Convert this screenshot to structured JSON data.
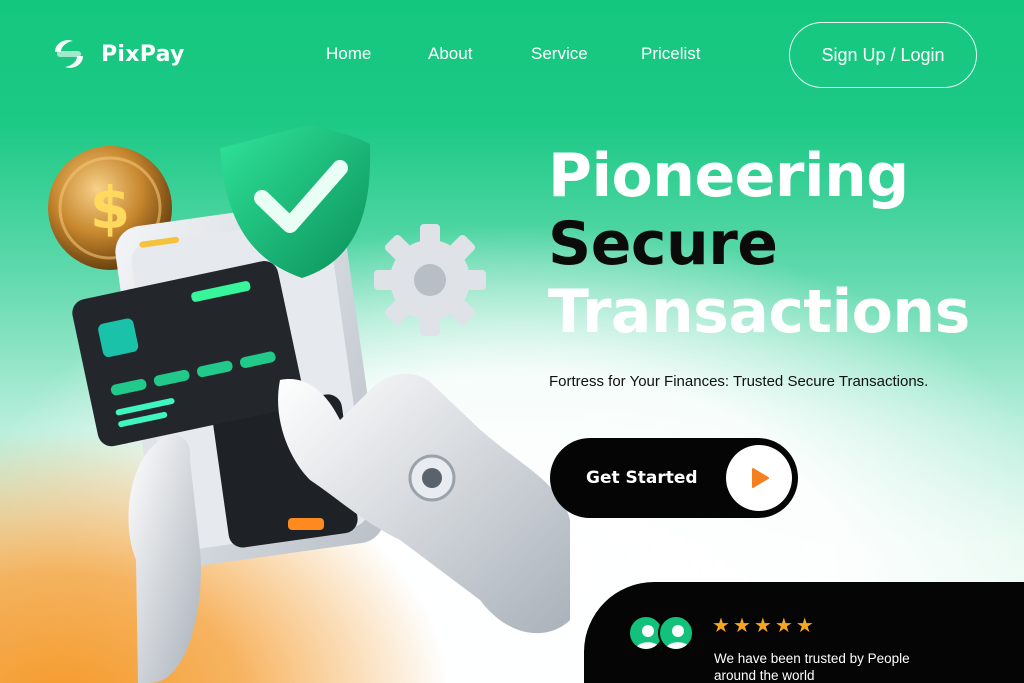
{
  "brand": {
    "name": "PixPay",
    "logo_icon": "pixpay-logo-icon"
  },
  "nav": {
    "items": [
      {
        "label": "Home"
      },
      {
        "label": "About"
      },
      {
        "label": "Service"
      },
      {
        "label": "Pricelist"
      }
    ],
    "signup_label": "Sign Up / Login"
  },
  "hero": {
    "title_line1": "Pioneering",
    "title_line2": "Secure",
    "title_line3": "Transactions",
    "subtitle": "Fortress for Your Finances: Trusted Secure Transactions.",
    "cta_label": "Get Started",
    "cta_icon": "play-icon"
  },
  "trust": {
    "rating": 5,
    "rating_max": 5,
    "text": "We have been trusted by People around the world"
  },
  "illustration": {
    "items": [
      "coin-dollar-icon",
      "shield-check-icon",
      "gear-icon",
      "phone-icon",
      "credit-card-icon",
      "robot-hands-icon"
    ]
  },
  "colors": {
    "brand_green": "#14c77e",
    "accent_orange": "#f5801f",
    "star": "#f5a623",
    "dark": "#050505"
  }
}
